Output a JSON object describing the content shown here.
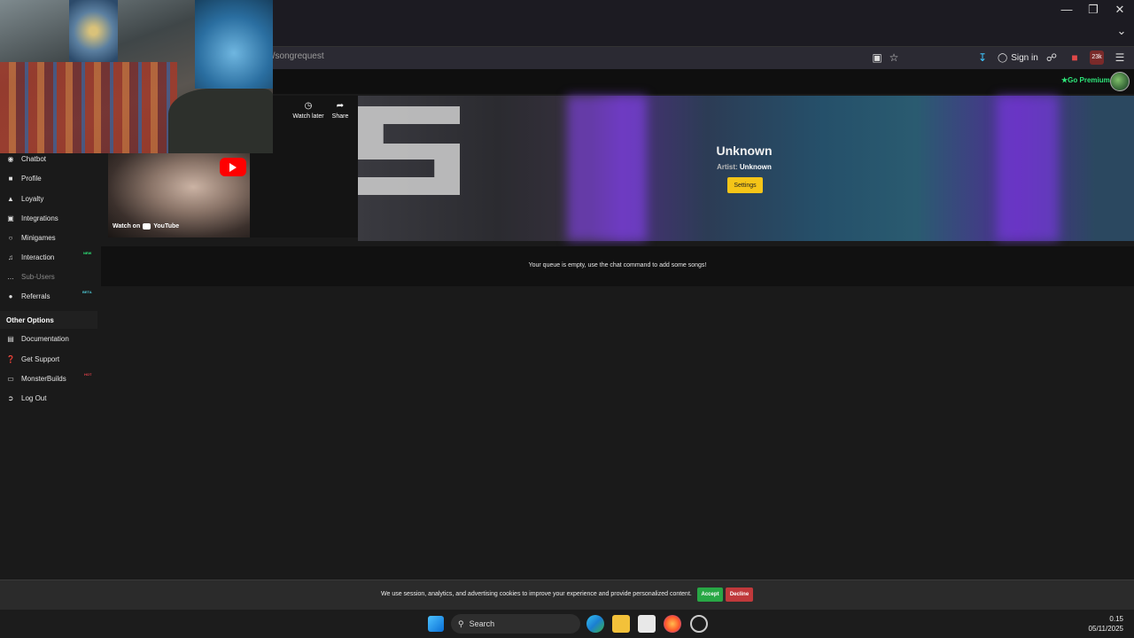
{
  "browser": {
    "url_fragment": "el/songrequest",
    "sign_in": "Sign in",
    "badge_count": "23k",
    "window_controls": [
      "minimize-icon",
      "restore-icon",
      "close-icon"
    ]
  },
  "header": {
    "go_premium": "Go Premium"
  },
  "video": {
    "watch_later": "Watch later",
    "share": "Share",
    "watch_on": "Watch on",
    "brand": "YouTube"
  },
  "now_playing": {
    "title": "Unknown",
    "artist_label": "Artist:",
    "artist_value": "Unknown",
    "settings_label": "Settings"
  },
  "queue": {
    "empty_message": "Your queue is empty, use the chat command to add some songs!"
  },
  "sidebar": {
    "items": [
      {
        "label": "Chatbot",
        "icon": "chatbot-icon"
      },
      {
        "label": "Profile",
        "icon": "profile-icon"
      },
      {
        "label": "Loyalty",
        "icon": "trophy-icon"
      },
      {
        "label": "Integrations",
        "icon": "integrations-icon"
      },
      {
        "label": "Minigames",
        "icon": "gamepad-icon"
      },
      {
        "label": "Interaction",
        "icon": "music-icon",
        "badge": "NEW"
      },
      {
        "label": "Sub-Users",
        "icon": "sub-users-icon"
      },
      {
        "label": "Referrals",
        "icon": "users-icon",
        "badge": "BETA"
      }
    ],
    "section_label": "Other Options",
    "other_items": [
      {
        "label": "Documentation",
        "icon": "document-icon"
      },
      {
        "label": "Get Support",
        "icon": "help-icon"
      },
      {
        "label": "MonsterBuilds",
        "icon": "laptop-icon",
        "badge": "HOT"
      },
      {
        "label": "Log Out",
        "icon": "logout-icon"
      }
    ]
  },
  "cookie_bar": {
    "text": "We use session, analytics, and advertising cookies to improve your experience and provide personalized content.",
    "accept": "Accept",
    "decline": "Decline"
  },
  "taskbar": {
    "search_label": "Search",
    "time": "0.15",
    "date": "05/11/2025"
  },
  "colors": {
    "accent_yellow": "#f5c518",
    "premium_green": "#2ee87a",
    "accept_green": "#28a745",
    "decline_red": "#c0393b",
    "new_badge": "#2ee87a",
    "beta_badge": "#4ec9d6",
    "hot_badge": "#e0404a"
  }
}
